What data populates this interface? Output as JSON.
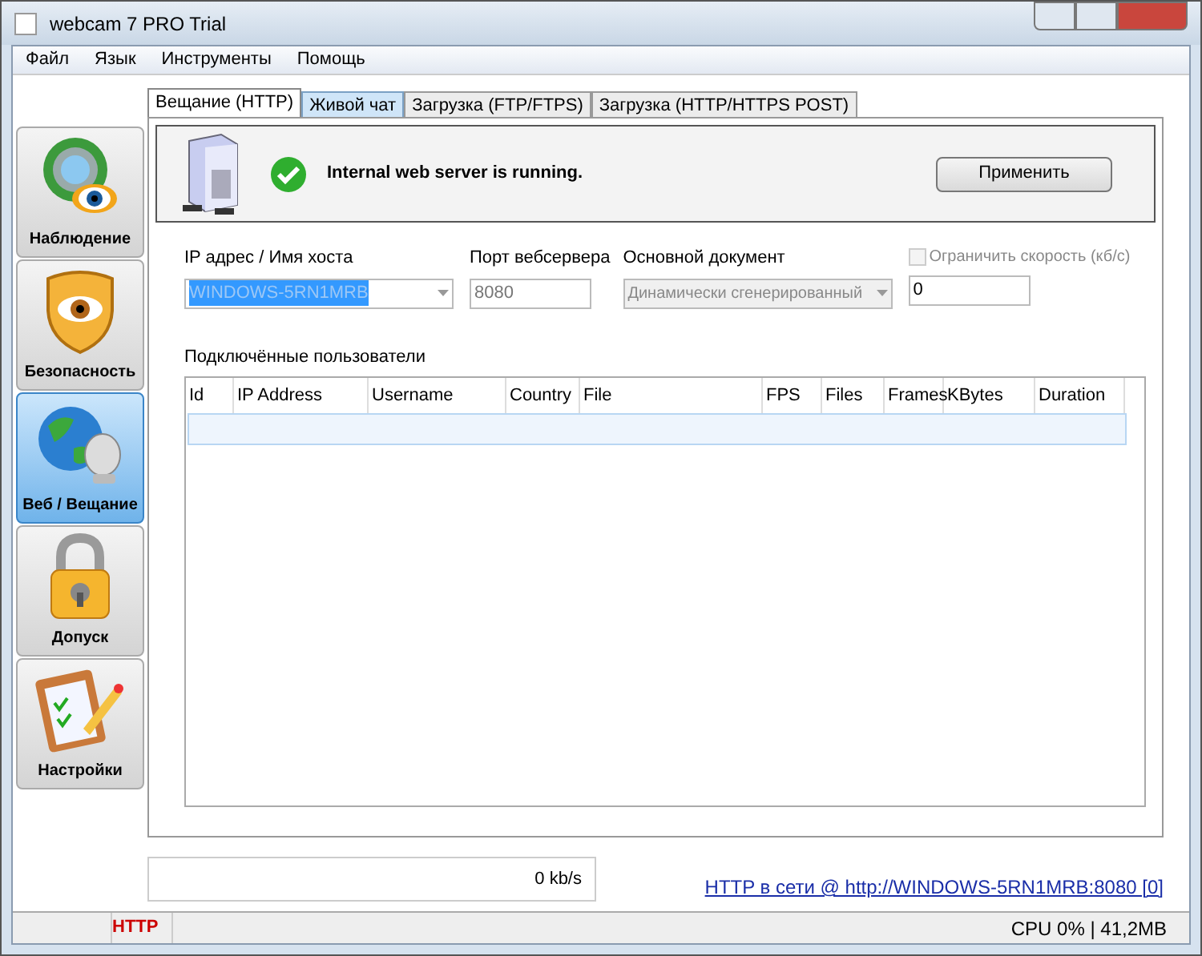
{
  "window": {
    "title": "webcam 7 PRO Trial"
  },
  "menu": [
    "Файл",
    "Язык",
    "Инструменты",
    "Помощь"
  ],
  "sidebar": [
    {
      "kind": "monitor",
      "label": "Наблюдение",
      "selected": false
    },
    {
      "kind": "shield",
      "label": "Безопасность",
      "selected": false
    },
    {
      "kind": "globe",
      "label": "Веб / Вещание",
      "selected": true
    },
    {
      "kind": "lock",
      "label": "Допуск",
      "selected": false
    },
    {
      "kind": "clipboard",
      "label": "Настройки",
      "selected": false
    }
  ],
  "tabs": [
    {
      "label": "Вещание (HTTP)",
      "selected": true
    },
    {
      "label": "Живой чат",
      "selected": false
    },
    {
      "label": "Загрузка (FTP/FTPS)",
      "selected": false
    },
    {
      "label": "Загрузка (HTTP/HTTPS POST)",
      "selected": false
    }
  ],
  "server": {
    "status": "Internal web server is running.",
    "running": true,
    "apply": "Применить"
  },
  "host": {
    "label": "IP адрес / Имя хоста",
    "value": "WINDOWS-5RN1MRB"
  },
  "port": {
    "label": "Порт вебсервера",
    "value": "8080"
  },
  "document": {
    "label": "Основной документ",
    "value": "Динамически сгенерированный",
    "disabled": true
  },
  "limit": {
    "label": "Ограничить скорость (кб/с)",
    "checked": false,
    "disabled": true,
    "value": "0"
  },
  "users": {
    "label": "Подключённые пользователи",
    "columns": [
      "Id",
      "IP Address",
      "Username",
      "Country",
      "File",
      "FPS",
      "Files",
      "Frames",
      "KBytes",
      "Duration"
    ]
  },
  "speed": "0 kb/s",
  "link": "HTTP в сети @ http://WINDOWS-5RN1MRB:8080 [0]",
  "status_bar": {
    "protocol": "HTTP",
    "resources": "CPU 0% | 41,2MB"
  }
}
